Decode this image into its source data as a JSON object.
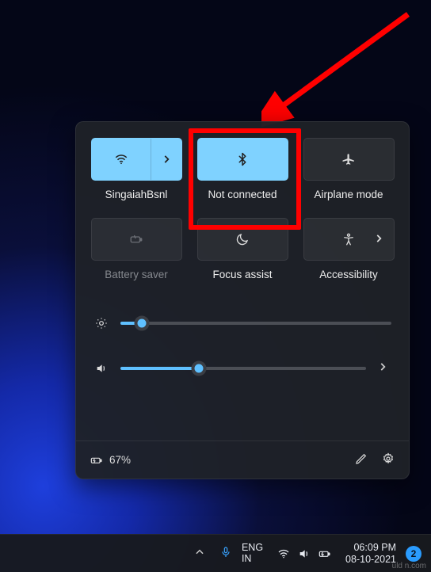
{
  "annotation": {
    "arrow_color": "#ff0000"
  },
  "panel": {
    "tiles": [
      {
        "id": "wifi",
        "label": "SingaiahBsnl",
        "active": true,
        "split": true
      },
      {
        "id": "bluetooth",
        "label": "Not connected",
        "active": true
      },
      {
        "id": "airplane",
        "label": "Airplane mode",
        "active": false
      },
      {
        "id": "battery-saver",
        "label": "Battery saver",
        "active": false,
        "dim": true
      },
      {
        "id": "focus-assist",
        "label": "Focus assist",
        "active": false
      },
      {
        "id": "accessibility",
        "label": "Accessibility",
        "active": false,
        "chevron": true
      }
    ],
    "brightness_pct": 8,
    "volume_pct": 32,
    "battery_text": "67%"
  },
  "taskbar": {
    "lang_line1": "ENG",
    "lang_line2": "IN",
    "time": "06:09 PM",
    "date": "08-10-2021",
    "notif_count": "2"
  },
  "watermark": "uld n.com"
}
